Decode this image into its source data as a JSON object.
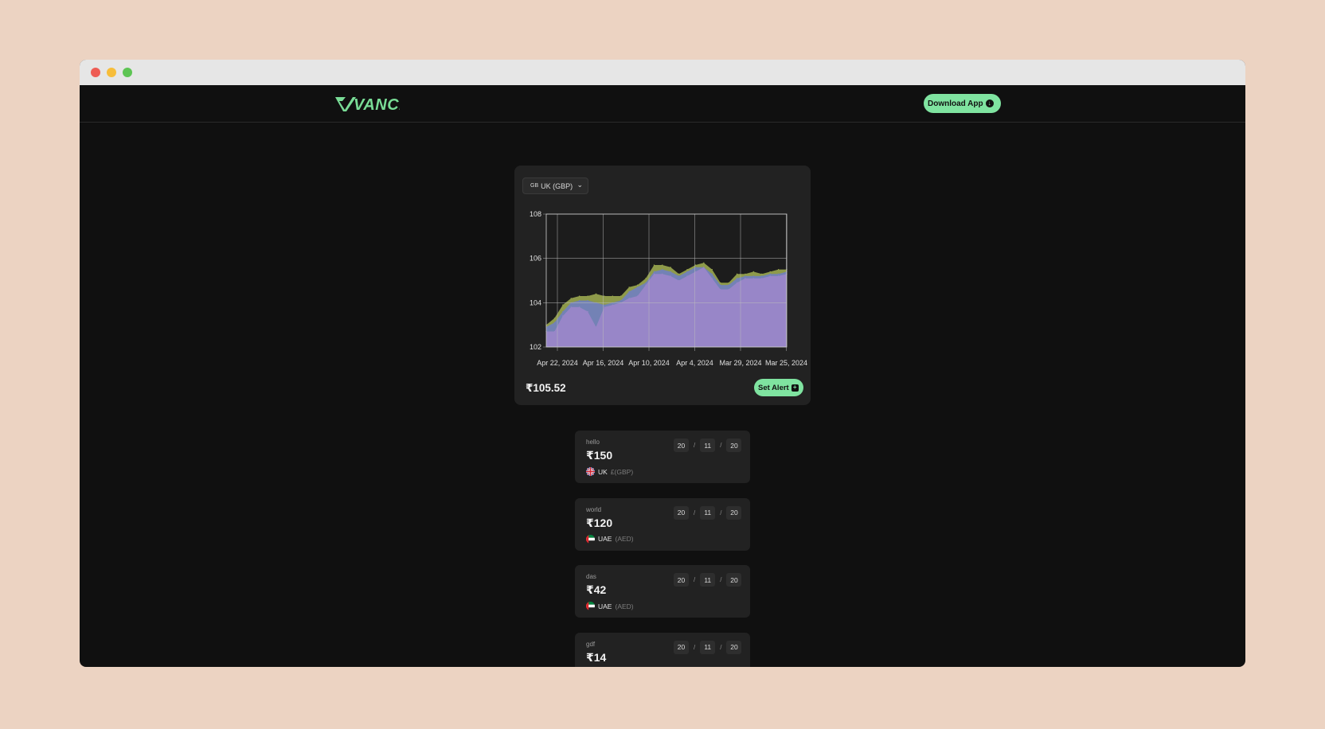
{
  "brand": {
    "logo": "VANCE",
    "accent": "#7fe3a0"
  },
  "nav": {
    "download_label": "Download App"
  },
  "converter": {
    "flag_code": "GB",
    "selected_currency": "UK (GBP)",
    "price": "₹105.52",
    "set_alert_label": "Set Alert"
  },
  "chart_data": {
    "type": "area",
    "x": [
      "Apr 22, 2024",
      "Apr 16, 2024",
      "Apr 10, 2024",
      "Apr 4, 2024",
      "Mar 29, 2024",
      "Mar 25, 2024"
    ],
    "ylim": [
      102,
      108
    ],
    "yticks": [
      102,
      104,
      106,
      108
    ],
    "grid": true,
    "series": [
      {
        "color": "#a2b052",
        "values": [
          103.0,
          103.3,
          103.9,
          104.2,
          104.3,
          104.3,
          104.4,
          104.3,
          104.3,
          104.3,
          104.7,
          104.8,
          105.1,
          105.7,
          105.7,
          105.6,
          105.3,
          105.5,
          105.7,
          105.8,
          105.5,
          104.9,
          104.9,
          105.3,
          105.3,
          105.4,
          105.3,
          105.4,
          105.5,
          105.5
        ]
      },
      {
        "color": "#6e7ec8",
        "values": [
          102.9,
          103.1,
          103.6,
          104.0,
          104.1,
          104.1,
          104.0,
          103.9,
          104.0,
          104.1,
          104.5,
          104.7,
          104.9,
          105.4,
          105.5,
          105.4,
          105.2,
          105.4,
          105.6,
          105.6,
          105.3,
          104.8,
          104.8,
          105.1,
          105.2,
          105.2,
          105.2,
          105.3,
          105.3,
          105.4
        ]
      },
      {
        "color": "#9a86c9",
        "values": [
          102.7,
          102.7,
          103.4,
          103.8,
          103.8,
          103.6,
          102.9,
          103.8,
          103.9,
          104.0,
          104.2,
          104.3,
          104.8,
          105.3,
          105.3,
          105.2,
          105.0,
          105.2,
          105.4,
          105.6,
          105.1,
          104.6,
          104.6,
          104.9,
          105.1,
          105.1,
          105.1,
          105.2,
          105.2,
          105.3
        ]
      }
    ]
  },
  "alerts": [
    {
      "name": "hello",
      "amount": "₹150",
      "country": "UK",
      "currency": "£(GBP)",
      "flag": "gb",
      "date": {
        "d": "20",
        "m": "11",
        "y": "20"
      }
    },
    {
      "name": "world",
      "amount": "₹120",
      "country": "UAE",
      "currency": "(AED)",
      "flag": "ae",
      "date": {
        "d": "20",
        "m": "11",
        "y": "20"
      }
    },
    {
      "name": "das",
      "amount": "₹42",
      "country": "UAE",
      "currency": "(AED)",
      "flag": "ae",
      "date": {
        "d": "20",
        "m": "11",
        "y": "20"
      }
    },
    {
      "name": "gdf",
      "amount": "₹14",
      "country": "",
      "currency": "",
      "flag": "",
      "date": {
        "d": "20",
        "m": "11",
        "y": "20"
      }
    }
  ],
  "date_separator": "/"
}
